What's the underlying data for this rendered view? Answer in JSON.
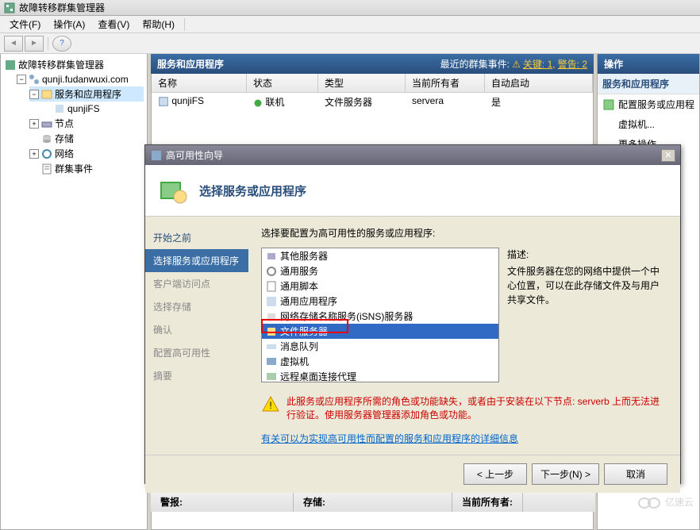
{
  "window": {
    "title": "故障转移群集管理器"
  },
  "menu": {
    "file": "文件(F)",
    "action": "操作(A)",
    "view": "查看(V)",
    "help": "帮助(H)"
  },
  "tree": {
    "root": "故障转移群集管理器",
    "cluster": "qunji.fudanwuxi.com",
    "services": "服务和应用程序",
    "service_item": "qunjiFS",
    "nodes": "节点",
    "storage": "存储",
    "networks": "网络",
    "events": "群集事件"
  },
  "center": {
    "header": "服务和应用程序",
    "recent_events_label": "最近的群集事件:",
    "event_critical": "关键: 1,",
    "event_warning": "警告: 2",
    "cols": {
      "name": "名称",
      "status": "状态",
      "type": "类型",
      "owner": "当前所有者",
      "auto": "自动启动"
    },
    "row": {
      "name": "qunjiFS",
      "status": "联机",
      "type": "文件服务器",
      "owner": "servera",
      "auto": "是"
    },
    "bottom": {
      "alert": "警报:",
      "storage": "存储:",
      "owner": "当前所有者:"
    }
  },
  "actions": {
    "header": "操作",
    "group": "服务和应用程序",
    "configure": "配置服务或应用程",
    "vm": "虚拟机...",
    "more": "更多操作"
  },
  "wizard": {
    "title": "高可用性向导",
    "heading": "选择服务或应用程序",
    "steps": {
      "before": "开始之前",
      "select": "选择服务或应用程序",
      "client": "客户端访问点",
      "storage": "选择存储",
      "confirm": "确认",
      "configure": "配置高可用性",
      "summary": "摘要"
    },
    "prompt": "选择要配置为高可用性的服务或应用程序:",
    "options": {
      "other": "其他服务器",
      "generic_service": "通用服务",
      "generic_script": "通用脚本",
      "generic_app": "通用应用程序",
      "isns": "网络存储名称服务(iSNS)服务器",
      "file_server": "文件服务器",
      "msmq": "消息队列",
      "vm": "虚拟机",
      "rdp_broker": "远程桌面连接代理"
    },
    "desc_label": "描述:",
    "desc_text": "文件服务器在您的网络中提供一个中心位置，可以在此存储文件及与用户共享文件。",
    "warning": "此服务或应用程序所需的角色或功能缺失，或者由于安装在以下节点: serverb 上而无法进行验证。使用服务器管理器添加角色或功能。",
    "link": "有关可以为实现高可用性而配置的服务和应用程序的详细信息",
    "btn_prev": "< 上一步",
    "btn_next": "下一步(N) >",
    "btn_cancel": "取消"
  },
  "watermark": "亿速云"
}
